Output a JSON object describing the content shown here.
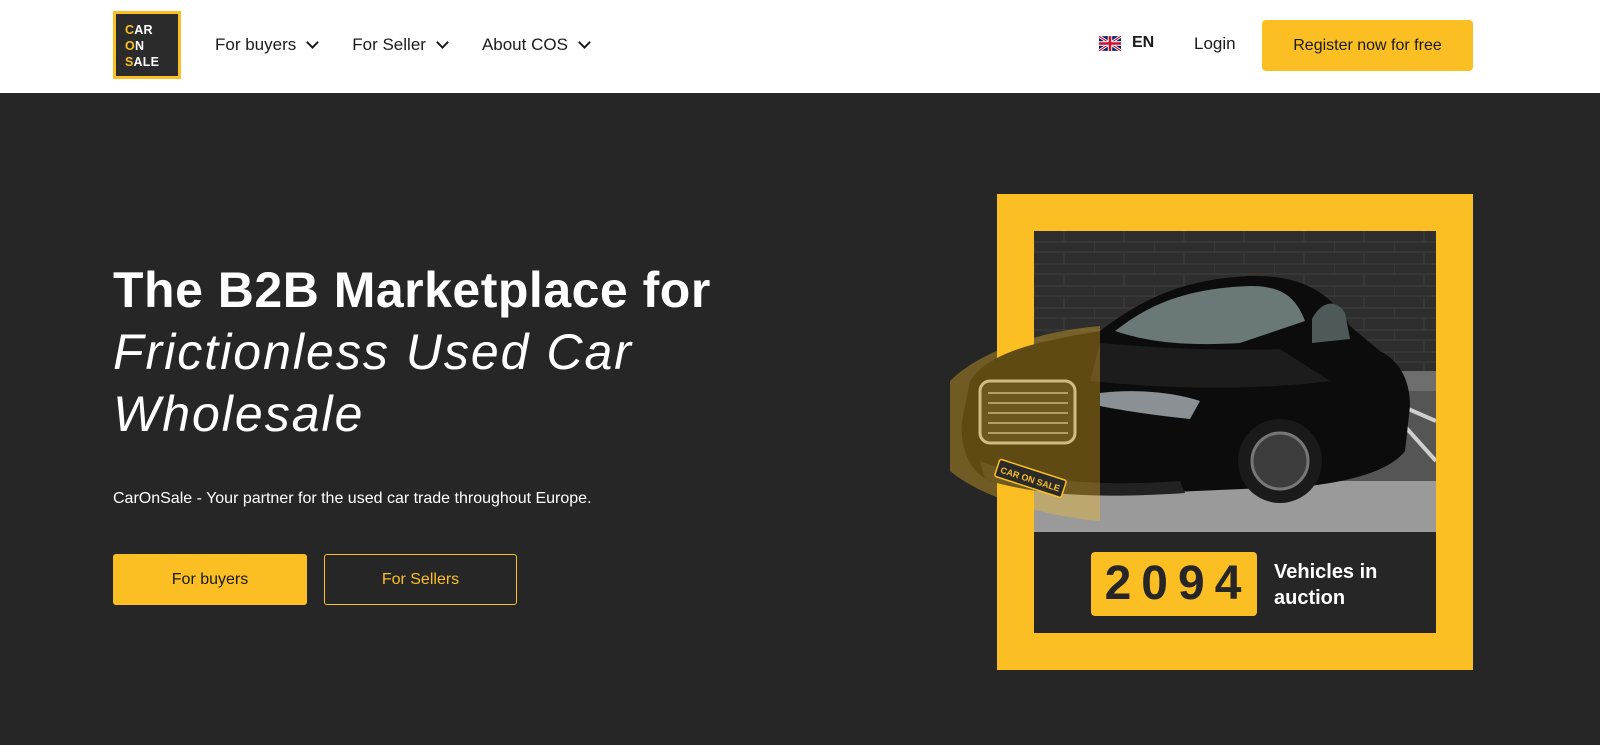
{
  "brand": {
    "logo_line1_accent": "C",
    "logo_line1_rest": "AR",
    "logo_line2_accent": "O",
    "logo_line2_rest": "N",
    "logo_line3_accent": "S",
    "logo_line3_rest": "ALE",
    "car_plate_text": "CAR ON SALE"
  },
  "nav": {
    "items": [
      {
        "label": "For buyers"
      },
      {
        "label": "For Seller"
      },
      {
        "label": "About COS"
      }
    ]
  },
  "header": {
    "language": "EN",
    "login_label": "Login",
    "register_label": "Register now for free"
  },
  "hero": {
    "title_bold": "The B2B Marketplace for",
    "title_italic": "Frictionless Used Car Wholesale",
    "subtitle": "CarOnSale - Your partner for the used car trade throughout Europe.",
    "buyers_button": "For buyers",
    "sellers_button": "For Sellers"
  },
  "stats": {
    "count": "2094",
    "label": "Vehicles in auction"
  },
  "icons": {
    "chevron": "chevron-down-icon",
    "flag": "uk-flag-icon"
  },
  "colors": {
    "accent": "#fbbf24",
    "dark_bg": "#262626",
    "header_bg": "#ffffff"
  }
}
